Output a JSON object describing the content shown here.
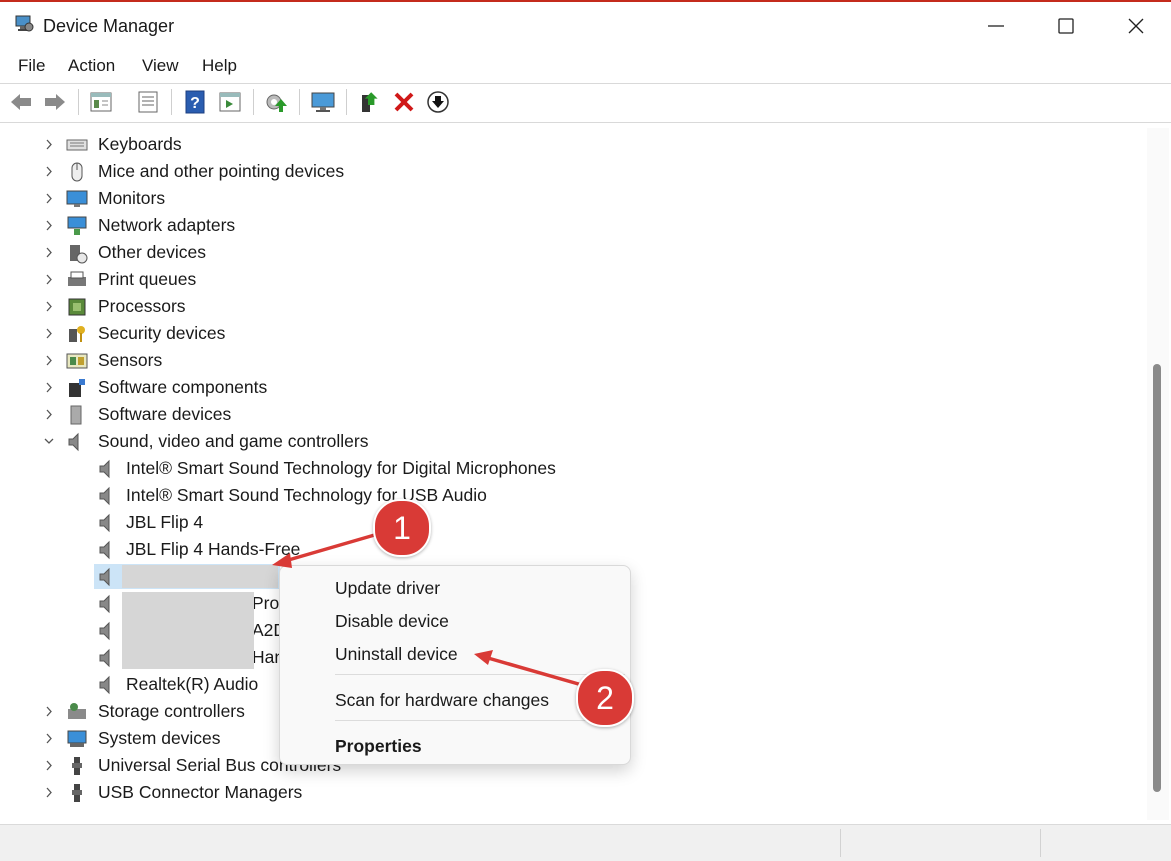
{
  "window": {
    "title": "Device Manager"
  },
  "menu": [
    "File",
    "Action",
    "View",
    "Help"
  ],
  "toolbar": {
    "icons": [
      "back-icon",
      "forward-icon",
      "show-hide-tree-icon",
      "properties-icon",
      "help-icon",
      "show-hidden-icon",
      "scan-hardware-icon",
      "computer-icon",
      "update-driver-icon",
      "uninstall-icon",
      "disable-icon"
    ]
  },
  "tree": {
    "categories_top": [
      {
        "label": "Keyboards",
        "icon": "keyboard-icon"
      },
      {
        "label": "Mice and other pointing devices",
        "icon": "mouse-icon"
      },
      {
        "label": "Monitors",
        "icon": "monitor-icon"
      },
      {
        "label": "Network adapters",
        "icon": "network-icon"
      },
      {
        "label": "Other devices",
        "icon": "unknown-device-icon"
      },
      {
        "label": "Print queues",
        "icon": "printer-icon"
      },
      {
        "label": "Processors",
        "icon": "chip-icon"
      },
      {
        "label": "Security devices",
        "icon": "key-icon"
      },
      {
        "label": "Sensors",
        "icon": "sensor-icon"
      },
      {
        "label": "Software components",
        "icon": "puzzle-icon"
      },
      {
        "label": "Software devices",
        "icon": "software-device-icon"
      },
      {
        "label": "Sound, video and game controllers",
        "icon": "speaker-icon"
      }
    ],
    "sound_children": [
      "Intel® Smart Sound Technology for Digital Microphones",
      "Intel® Smart Sound Technology for USB Audio",
      "JBL Flip 4",
      "JBL Flip 4 Hands-Free"
    ],
    "sound_children_partial": [
      "Pro",
      "A2D",
      "Han"
    ],
    "sound_last": "Realtek(R) Audio",
    "categories_bottom": [
      {
        "label": "Storage controllers",
        "icon": "storage-icon"
      },
      {
        "label": "System devices",
        "icon": "system-icon"
      },
      {
        "label": "Universal Serial Bus controllers",
        "icon": "usb-icon"
      },
      {
        "label": "USB Connector Managers",
        "icon": "usb-icon"
      }
    ]
  },
  "context_menu": {
    "items": [
      "Update driver",
      "Disable device",
      "Uninstall device",
      "Scan for hardware changes",
      "Properties"
    ]
  },
  "annotations": {
    "step1": "1",
    "step2": "2"
  }
}
